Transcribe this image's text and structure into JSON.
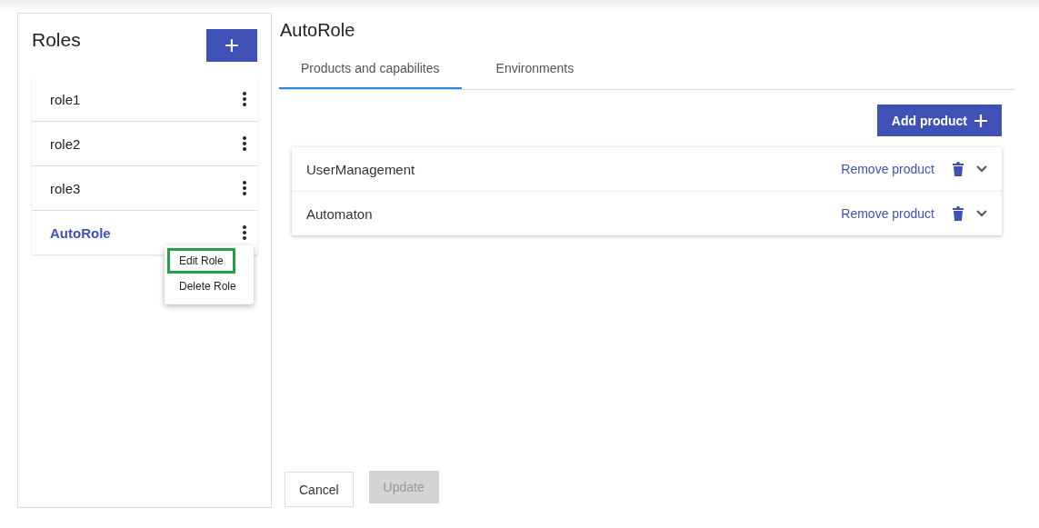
{
  "sidebar": {
    "title": "Roles",
    "add_button": "+",
    "roles": [
      {
        "name": "role1",
        "selected": false
      },
      {
        "name": "role2",
        "selected": false
      },
      {
        "name": "role3",
        "selected": false
      },
      {
        "name": "AutoRole",
        "selected": true
      }
    ],
    "menu": {
      "items": [
        {
          "label": "Edit Role",
          "highlighted": true
        },
        {
          "label": "Delete Role",
          "highlighted": false
        }
      ]
    }
  },
  "main": {
    "title": "AutoRole",
    "tabs": [
      {
        "label": "Products and capabilites",
        "selected": true
      },
      {
        "label": "Environments",
        "selected": false
      }
    ],
    "add_button": "Add product",
    "products": [
      {
        "name": "UserManagement",
        "remove": "Remove product",
        "expanded": false
      },
      {
        "name": "Automaton",
        "remove": "Remove product",
        "expanded": false
      }
    ],
    "buttons": [
      {
        "label": "Cancel",
        "disabled": false
      },
      {
        "label": "Update",
        "disabled": true
      }
    ]
  }
}
